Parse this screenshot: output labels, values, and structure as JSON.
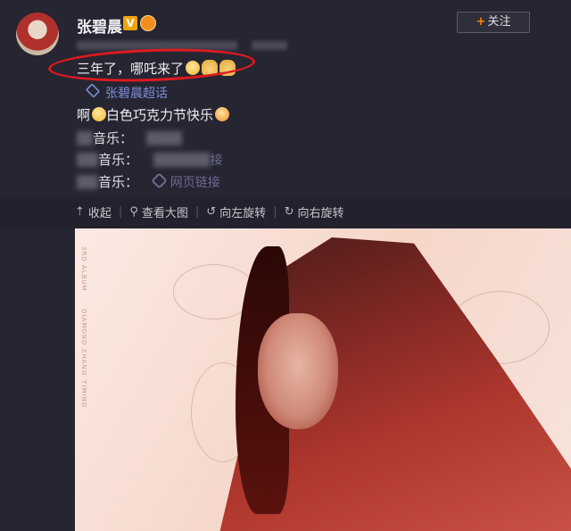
{
  "user": {
    "name": "张碧晨",
    "verify_mark": "V"
  },
  "follow_button": {
    "plus": "+",
    "label": "关注"
  },
  "post": {
    "text": "三年了，哪吒来了",
    "topic": "张碧晨超话",
    "line2_prefix": "啊",
    "line2_text": "白色巧克力节快乐",
    "music_label": "音乐：",
    "music_link_partial": "接",
    "music_link_full": "网页链接"
  },
  "toolbar": {
    "collapse": "收起",
    "view_large": "查看大图",
    "rotate_left": "向左旋转",
    "rotate_right": "向右旋转"
  },
  "photo": {
    "side_text_1": "3RD ALBUM",
    "side_text_2": "DIAMOND ZHANG",
    "side_text_3": "TIMING"
  },
  "colors": {
    "background": "#262532",
    "highlight_ellipse": "#e0191f",
    "link": "#7b8fd9",
    "follow_plus": "#ff8200"
  }
}
